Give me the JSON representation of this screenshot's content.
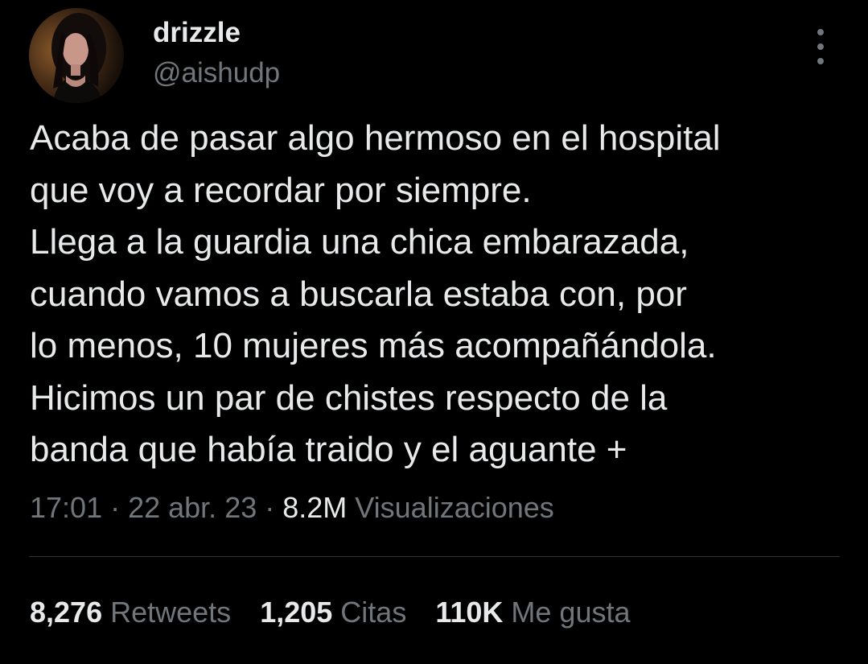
{
  "author": {
    "display_name": "drizzle",
    "handle": "@aishudp"
  },
  "tweet": {
    "lines": [
      "Acaba de pasar algo hermoso en el hospital",
      "que voy a recordar por siempre.",
      "Llega a la guardia una chica embarazada,",
      "cuando vamos a buscarla estaba con, por",
      "lo menos, 10 mujeres más acompañándola.",
      "Hicimos un par de chistes respecto de la",
      "banda que había traido y el aguante +"
    ]
  },
  "meta": {
    "time": "17:01",
    "separator": " · ",
    "date": "22 abr. 23",
    "views_count": "8.2M",
    "views_label": "Visualizaciones"
  },
  "stats": {
    "retweets": {
      "count": "8,276",
      "label": "Retweets"
    },
    "quotes": {
      "count": "1,205",
      "label": "Citas"
    },
    "likes": {
      "count": "110K",
      "label": "Me gusta"
    }
  },
  "icons": {
    "more": "more-vertical-icon"
  },
  "colors": {
    "background": "#000000",
    "primary_text": "#e7e9ea",
    "secondary_text": "#71767b",
    "divider": "#2f3336"
  }
}
